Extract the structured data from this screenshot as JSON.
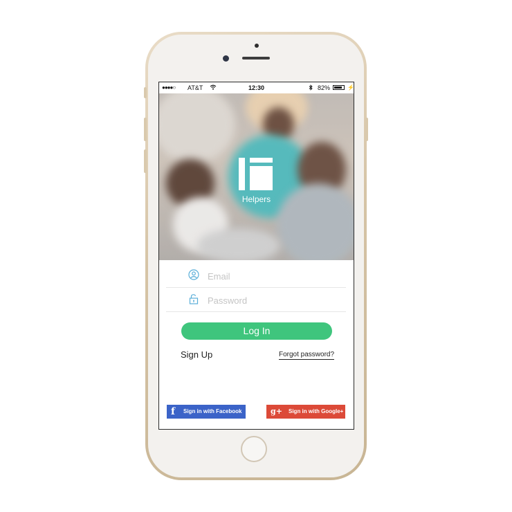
{
  "status_bar": {
    "signal": "●●●●○",
    "carrier": "AT&T",
    "wifi_icon": "wifi-icon",
    "time": "12:30",
    "bluetooth_icon": "bluetooth-icon",
    "battery_percent": "82%",
    "battery_level": 0.82
  },
  "hero": {
    "app_name": "Helpers",
    "logo_icon": "helpers-logo-icon"
  },
  "form": {
    "email_placeholder": "Email",
    "email_value": "",
    "password_placeholder": "Password",
    "password_value": "",
    "login_label": "Log In",
    "signup_label": "Sign Up",
    "forgot_label": "Forgot password?"
  },
  "social": {
    "facebook_label": "Sign in with Facebook",
    "facebook_glyph": "f",
    "google_label": "Sign in with Google+",
    "google_glyph": "g+"
  },
  "colors": {
    "accent_green": "#3fc57d",
    "facebook_blue": "#3b63c8",
    "google_red": "#dc4a38",
    "field_icon": "#5aaed8"
  }
}
